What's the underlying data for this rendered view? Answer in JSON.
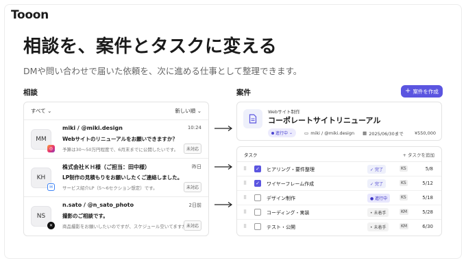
{
  "brand": {
    "logo": "Tooon"
  },
  "hero": {
    "headline": "相談を、案件とタスクに変える",
    "subline": "DMや問い合わせで届いた依頼を、次に進める仕事として整理できます。"
  },
  "inbox": {
    "section_label": "相談",
    "filter": "すべて",
    "sort": "新しい順",
    "messages": [
      {
        "initials": "MM",
        "channel": "instagram-icon",
        "sender": "miki / @miki.design",
        "time": "10:24",
        "subject": "Webサイトのリニューアルをお願いできますか？",
        "preview": "予算は30〜50万円程度で、6月末までに公開したいです。",
        "status": "未対応"
      },
      {
        "initials": "KH",
        "channel": "mail-icon",
        "sender": "株式会社ＫＨ様（ご担当：田中様）",
        "time": "昨日",
        "subject": "LP制作の見積もりをお願いしたくご連絡しました。",
        "preview": "サービス紹介LP（5〜6セクション想定）です。",
        "status": "未対応"
      },
      {
        "initials": "NS",
        "channel": "x-icon",
        "sender": "n.sato / @n_sato_photo",
        "time": "2日前",
        "subject": "撮影のご相談です。",
        "preview": "商品撮影をお願いしたいのですが、スケジュール空いてますか？",
        "status": "未対応"
      }
    ]
  },
  "project": {
    "section_label": "案件",
    "create_label": "案件を作成",
    "category": "Webサイト制作",
    "title": "コーポレートサイトリニューアル",
    "status": "進行中",
    "client": "miki / @miki.design",
    "due": "2025/06/30まで",
    "amount": "¥550,000"
  },
  "tasks": {
    "header": "タスク",
    "add_label": "タスクを追加",
    "items": [
      {
        "name": "ヒアリング・要件整理",
        "checked": true,
        "status": "完了",
        "status_kind": "done",
        "assignee": "KS",
        "date": "5/8"
      },
      {
        "name": "ワイヤーフレーム作成",
        "checked": true,
        "status": "完了",
        "status_kind": "done",
        "assignee": "KS",
        "date": "5/12"
      },
      {
        "name": "デザイン制作",
        "checked": false,
        "status": "進行中",
        "status_kind": "prog",
        "assignee": "KS",
        "date": "5/18"
      },
      {
        "name": "コーディング・実装",
        "checked": false,
        "status": "未着手",
        "status_kind": "todo",
        "assignee": "KM",
        "date": "5/28"
      },
      {
        "name": "テスト・公開",
        "checked": false,
        "status": "未着手",
        "status_kind": "todo",
        "assignee": "KM",
        "date": "6/30"
      }
    ]
  },
  "colors": {
    "accent": "#5b55e0",
    "accent_soft": "#ecebfd"
  }
}
